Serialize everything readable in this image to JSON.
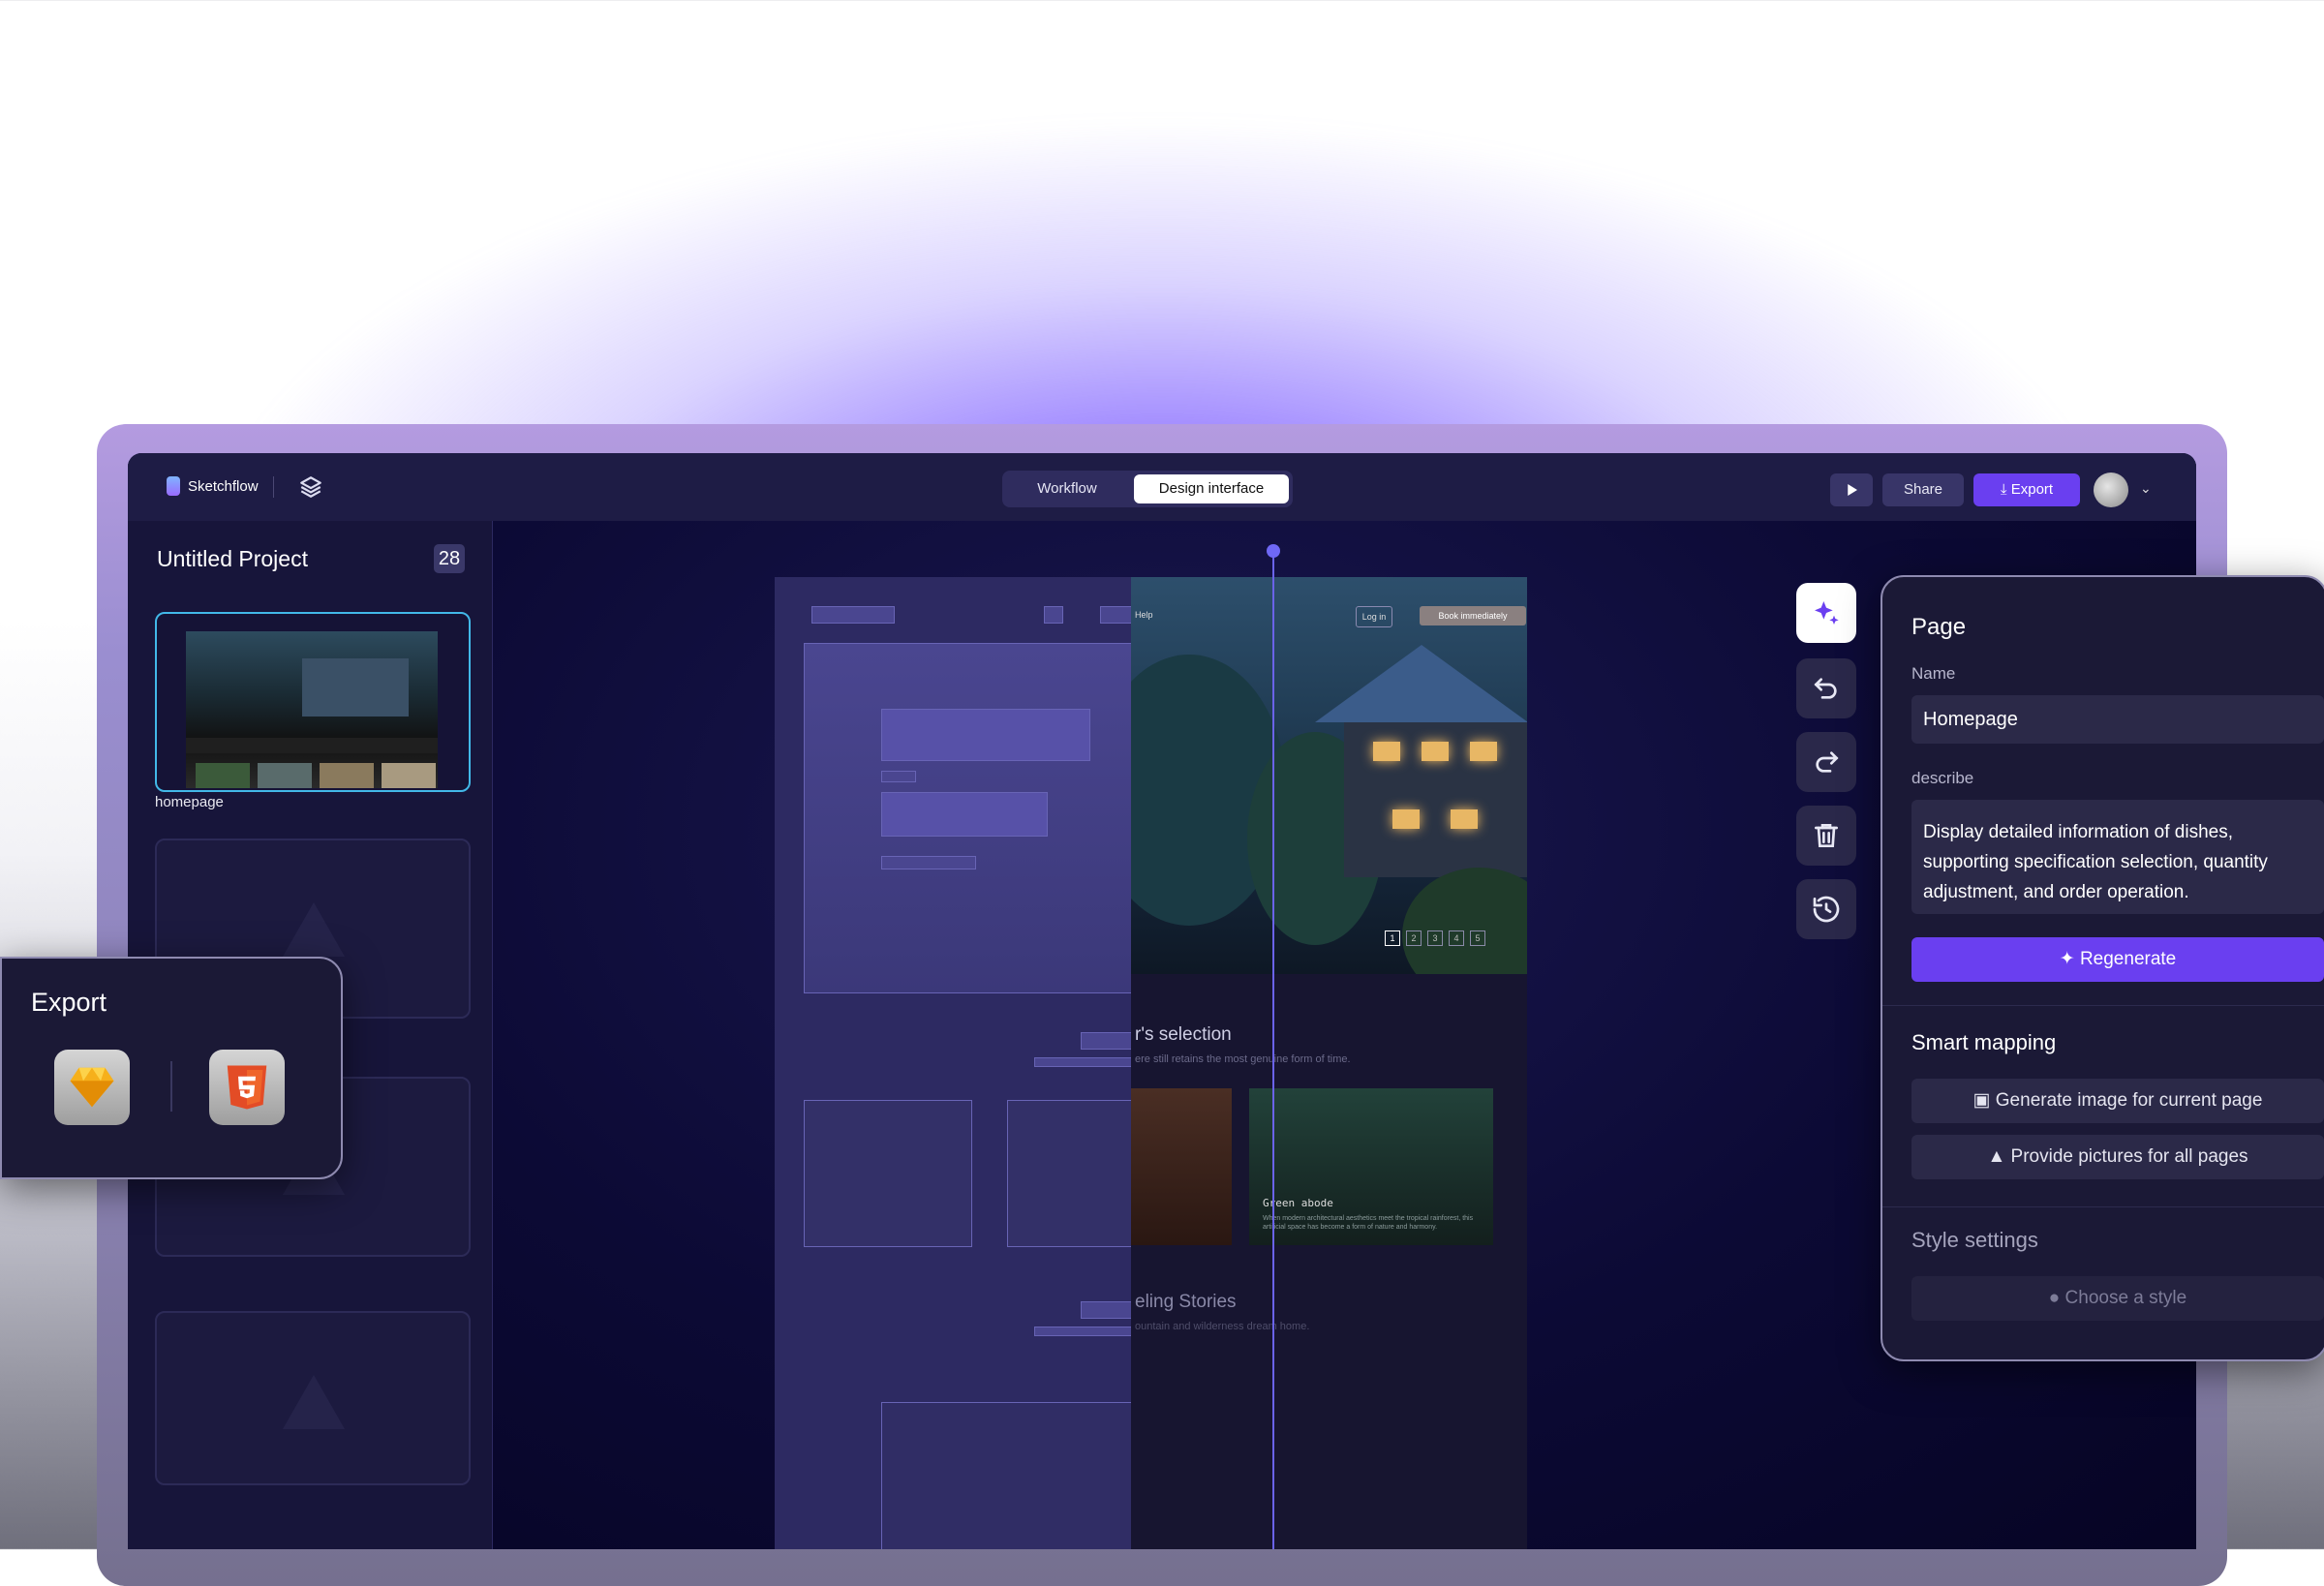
{
  "app": {
    "name": "Sketchflow"
  },
  "header": {
    "tabs": [
      "Workflow",
      "Design interface"
    ],
    "share_label": "Share",
    "export_label": "Export",
    "caret": "⌄"
  },
  "sidebar": {
    "project_title": "Untitled Project",
    "page_count": "28",
    "pages": [
      {
        "label": "homepage"
      }
    ]
  },
  "canvas": {
    "nav": {
      "help": "Help",
      "login": "Log in",
      "book": "Book immediately"
    },
    "pager": [
      "1",
      "2",
      "3",
      "4",
      "5"
    ],
    "section1": {
      "title": "r's selection",
      "subtitle": "ere still retains the most genuine form of time."
    },
    "card2": {
      "title": "Green abode",
      "text": "When modern architectural aesthetics meet the tropical rainforest, this artificial space has become a form of nature and harmony."
    },
    "section2": {
      "title": "eling Stories",
      "subtitle": "ountain and wilderness dream home."
    }
  },
  "panel": {
    "page_heading": "Page",
    "name_label": "Name",
    "name_value": "Homepage",
    "describe_label": "describe",
    "describe_value": "Display detailed information of dishes, supporting specification selection, quantity adjustment, and order operation.",
    "regenerate_label": "Regenerate",
    "smart_mapping_heading": "Smart mapping",
    "gen_image_label": "Generate image for current page",
    "provide_pictures_label": "Provide pictures for all pages",
    "style_heading": "Style settings",
    "choose_style_label": "Choose a style"
  },
  "export_card": {
    "title": "Export"
  },
  "colors": {
    "accent": "#6a3ff0",
    "background": "#0a0830",
    "panel": "#1b1936",
    "highlight": "#42b8e8"
  }
}
